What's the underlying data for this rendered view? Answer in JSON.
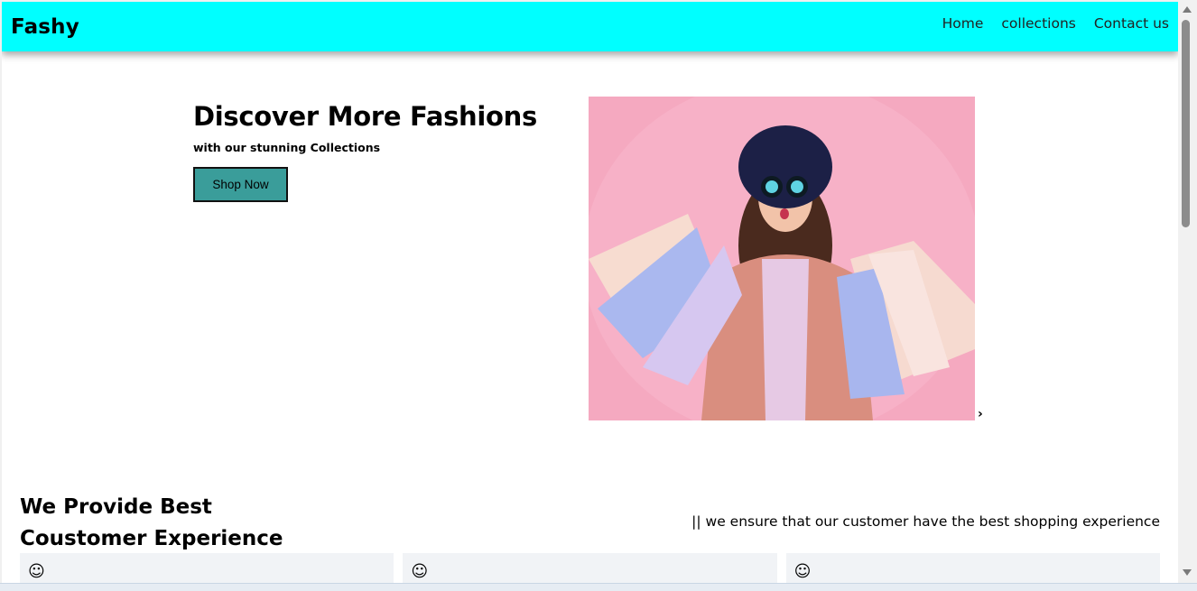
{
  "navbar": {
    "brand": "Fashy",
    "links": [
      "Home",
      "collections",
      "Contact us"
    ],
    "background": "#00ffff"
  },
  "hero": {
    "title": "Discover More Fashions",
    "subtitle": "with our stunning Collections",
    "button_label": "Shop Now",
    "button_color": "#3a9d9a",
    "next_arrow": "›"
  },
  "features": {
    "title_line1": "We Provide Best",
    "title_line2": "Coustomer Experience",
    "tagline": "|| we ensure that our customer have the best shopping experience",
    "cards": [
      {
        "icon": "☺"
      },
      {
        "icon": "☺"
      },
      {
        "icon": "☺"
      }
    ]
  }
}
